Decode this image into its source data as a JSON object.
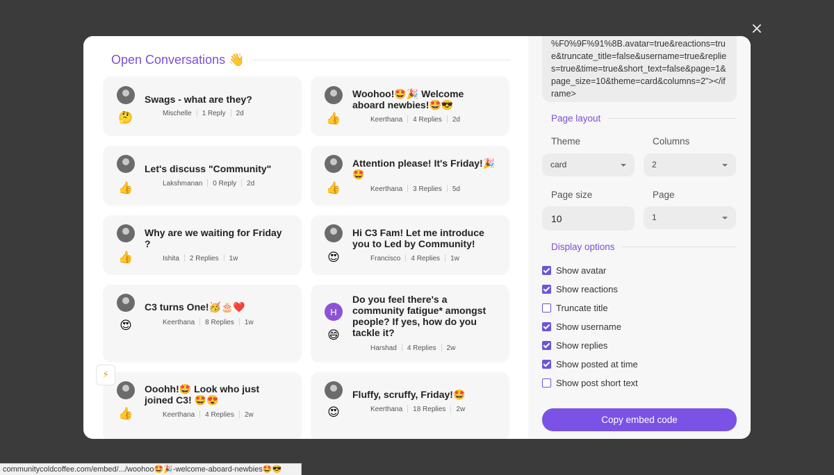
{
  "window": {
    "close_glyph": "×"
  },
  "preview": {
    "title": "Open Conversations 👋",
    "cards": [
      {
        "title": "Swags - what are they?",
        "reaction": "🤔",
        "author": "Mischelle",
        "replies": "1 Reply",
        "time": "2d"
      },
      {
        "title": "Woohoo!🤩🎉 Welcome aboard newbies!🤩😎",
        "reaction": "👍",
        "author": "Keerthana",
        "replies": "4 Replies",
        "time": "2d"
      },
      {
        "title": "Let's discuss \"Community\"",
        "reaction": "👍",
        "author": "Lakshmanan",
        "replies": "0 Reply",
        "time": "2d"
      },
      {
        "title": "Attention please! It's Friday!🎉🤩",
        "reaction": "👍",
        "author": "Keerthana",
        "replies": "3 Replies",
        "time": "5d"
      },
      {
        "title": "Why are we waiting for Friday ?",
        "reaction": "👍",
        "author": "Ishita",
        "replies": "2 Replies",
        "time": "1w"
      },
      {
        "title": "Hi C3 Fam! Let me introduce you to Led by Community!",
        "reaction": "😍",
        "author": "Francisco",
        "replies": "4 Replies",
        "time": "1w"
      },
      {
        "title": "C3 turns One!🥳🎂❤️",
        "reaction": "😍",
        "author": "Keerthana",
        "replies": "8 Replies",
        "time": "1w"
      },
      {
        "title": "Do you feel there's a community fatigue* amongst people? If yes, how do you tackle it?",
        "reaction": "😄",
        "author": "Harshad",
        "replies": "4 Replies",
        "time": "2w",
        "avatar_letter": "H"
      },
      {
        "title": "Ooohh!🤩 Look who just joined C3! 🤩😍",
        "reaction": "👍",
        "author": "Keerthana",
        "replies": "4 Replies",
        "time": "2w"
      },
      {
        "title": "Fluffy, scruffy, Friday!🤩",
        "reaction": "😍",
        "author": "Keerthana",
        "replies": "18 Replies",
        "time": "2w"
      }
    ],
    "bolt_glyph": "⚡"
  },
  "settings": {
    "embed_code": "%F0%9F%91%8B.avatar=true&reactions=true&truncate_title=false&username=true&replies=true&time=true&short_text=false&page=1&page_size=10&theme=card&columns=2\"></iframe>",
    "page_layout_label": "Page layout",
    "theme_label": "Theme",
    "theme_value": "card",
    "columns_label": "Columns",
    "columns_value": "2",
    "page_size_label": "Page size",
    "page_size_value": "10",
    "page_label": "Page",
    "page_value": "1",
    "display_options_label": "Display options",
    "options": [
      {
        "label": "Show avatar",
        "checked": true
      },
      {
        "label": "Show reactions",
        "checked": true
      },
      {
        "label": "Truncate title",
        "checked": false
      },
      {
        "label": "Show username",
        "checked": true
      },
      {
        "label": "Show replies",
        "checked": true
      },
      {
        "label": "Show posted at time",
        "checked": true
      },
      {
        "label": "Show post short text",
        "checked": false
      }
    ],
    "copy_button": "Copy embed code",
    "accent_color": "#7b52e6"
  },
  "status_bar": {
    "url": "communitycoldcoffee.com/embed/.../woohoo🤩🎉-welcome-aboard-newbies🤩😎"
  }
}
